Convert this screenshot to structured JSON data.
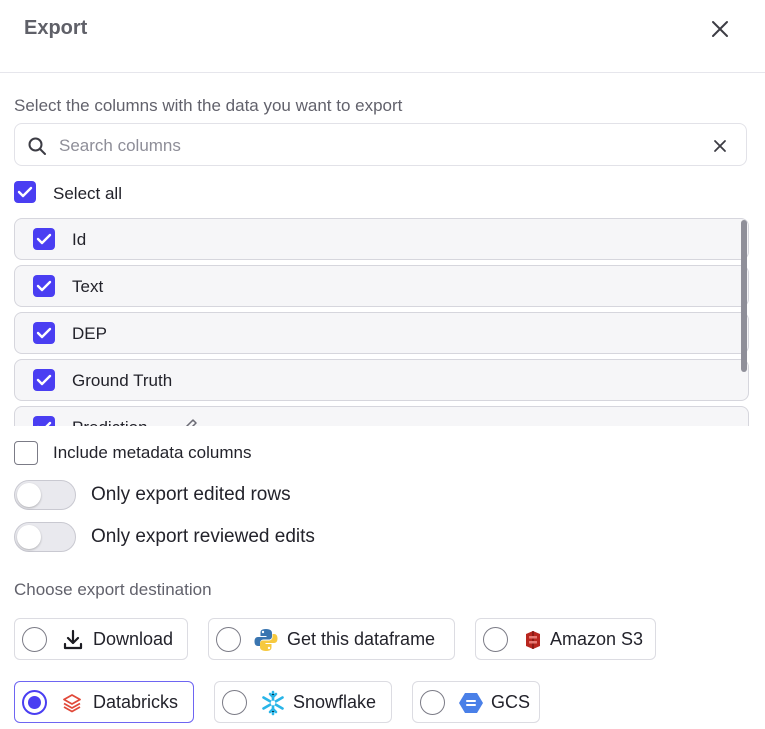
{
  "dialog": {
    "title": "Export"
  },
  "columns_section": {
    "label": "Select the columns with the data you want to export",
    "search_placeholder": "Search columns",
    "search_value": "",
    "select_all_label": "Select all",
    "select_all_checked": true,
    "items": [
      {
        "label": "Id",
        "checked": true
      },
      {
        "label": "Text",
        "checked": true
      },
      {
        "label": "DEP",
        "checked": true
      },
      {
        "label": "Ground Truth",
        "checked": true
      },
      {
        "label": "Prediction",
        "checked": true,
        "icon": "pencil-icon"
      }
    ]
  },
  "options": {
    "include_metadata_label": "Include metadata columns",
    "include_metadata_checked": false,
    "edited_rows_label": "Only export edited rows",
    "edited_rows_on": false,
    "reviewed_edits_label": "Only export reviewed edits",
    "reviewed_edits_on": false
  },
  "destination": {
    "label": "Choose export destination",
    "selected": "Databricks",
    "options": [
      {
        "label": "Download",
        "icon": "download-icon"
      },
      {
        "label": "Get this dataframe",
        "icon": "python-icon"
      },
      {
        "label": "Amazon S3",
        "icon": "amazon-s3-icon"
      },
      {
        "label": "Databricks",
        "icon": "databricks-icon"
      },
      {
        "label": "Snowflake",
        "icon": "snowflake-icon"
      },
      {
        "label": "GCS",
        "icon": "gcs-icon"
      }
    ]
  },
  "colors": {
    "accent": "#4a3ef2",
    "python_blue": "#3a75b0",
    "python_yellow": "#f6c93f",
    "s3_red": "#b8261e",
    "databricks_red": "#e1493a",
    "snowflake_cyan": "#29b5e8",
    "gcs_blue": "#4a80e8"
  }
}
